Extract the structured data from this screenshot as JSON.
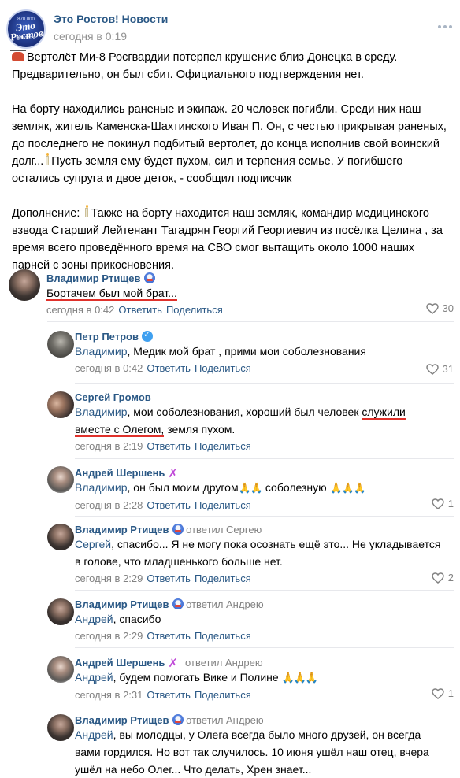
{
  "post": {
    "group_name": "Это Ростов! Новости",
    "time": "сегодня в 0:19",
    "logo_top": "870 000",
    "logo_main": "Это Ростов",
    "logo_bottom": "НОВОСТИ",
    "paragraph1": "Вертолёт Ми-8 Росгвардии потерпел крушение близ Донецка в среду. Предварительно, он был сбит. Официального подтверждения нет.",
    "paragraph2a": "На борту находились раненые и экипаж. 20 человек погибли. Среди них наш земляк, житель Каменска-Шахтинского Иван П. Он, с честью прикрывая раненых, до последнего не покинул подбитый вертолет, до конца исполнив свой воинский долг...",
    "paragraph2b": "Пусть земля ему будет пухом, сил и терпения семье. У погибшего остались супруга и двое деток, - сообщил подписчик",
    "paragraph3a": "Дополнение:",
    "paragraph3b": "Также на борту находится наш земляк, командир медицинского взвода Старший Лейтенант Тагадрян Георгий Георгиевич из посёлка Целина , за время всего проведённого время на СВО смог вытащить около 1000 наших парней с зоны прикосновения."
  },
  "ui": {
    "reply": "Ответить",
    "share": "Поделиться"
  },
  "comments": [
    {
      "author": "Владимир Ртищев",
      "text": "Бортачем был мой брат...",
      "time": "сегодня в 0:42",
      "likes": "30"
    },
    {
      "author": "Петр Петров",
      "ref": "Владимир",
      "text": ", Медик мой брат , прими мои соболезнования",
      "time": "сегодня в 0:42",
      "likes": "31"
    },
    {
      "author": "Сергей Громов",
      "ref": "Владимир",
      "text1": ", мои соболезнования, хороший был человек ",
      "text2": "служили",
      "text3": "вместе с Олегом,",
      "text4": " земля пухом.",
      "time": "сегодня в 2:19"
    },
    {
      "author": "Андрей Шершень",
      "ref": "Владимир",
      "text": ", он был моим другом",
      "text_b": " соболезную",
      "time": "сегодня в 2:28",
      "likes": "1"
    },
    {
      "author": "Владимир Ртищев",
      "replied": "ответил Сергею",
      "ref": "Сергей",
      "text": ", спасибо... Я не могу пока осознать ещё это... Не укладывается в голове, что младшенького больше нет.",
      "time": "сегодня в 2:29",
      "likes": "2"
    },
    {
      "author": "Владимир Ртищев",
      "replied": "ответил Андрею",
      "ref": "Андрей",
      "text": ", спасибо",
      "time": "сегодня в 2:29"
    },
    {
      "author": "Андрей Шершень",
      "replied": "ответил Андрею",
      "ref": "Андрей",
      "text": ", будем помогать Вике и Полине",
      "time": "сегодня в 2:31",
      "likes": "1"
    },
    {
      "author": "Владимир Ртищев",
      "replied": "ответил Андрею",
      "ref": "Андрей",
      "text": ", вы молодцы, у Олега всегда было много друзей, он всегда вами гордился. Но вот так случилось. 10 июня ушёл наш отец, вчера ушёл на небо Олег... Что делать, Хрен знает..."
    }
  ]
}
